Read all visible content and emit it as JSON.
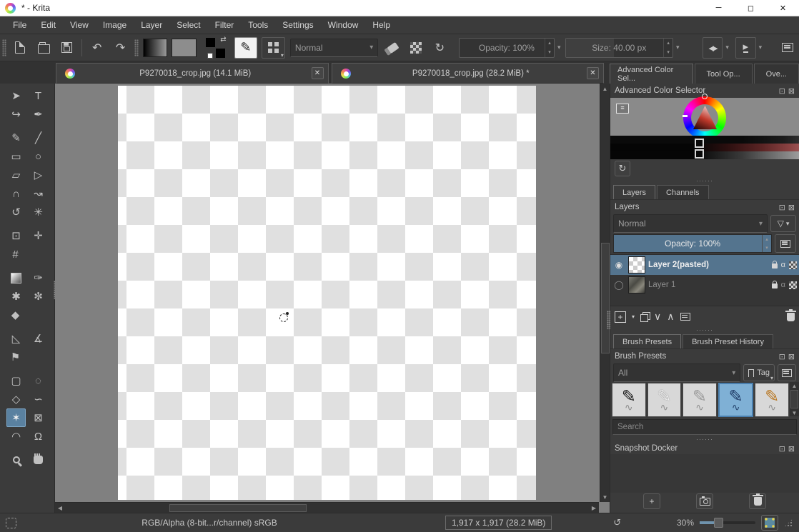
{
  "window": {
    "title": "* - Krita"
  },
  "window_controls": {
    "minimize": "─",
    "maximize": "◻",
    "close": "✕"
  },
  "menubar": {
    "items": [
      "File",
      "Edit",
      "View",
      "Image",
      "Layer",
      "Select",
      "Filter",
      "Tools",
      "Settings",
      "Window",
      "Help"
    ]
  },
  "toolbar": {
    "blending_mode": "Normal",
    "opacity": "Opacity: 100%",
    "size": "Size: 40.00 px"
  },
  "doc_tabs": [
    {
      "label": "P9270018_crop.jpg (14.1 MiB)"
    },
    {
      "label": "P9270018_crop.jpg (28.2 MiB) *"
    }
  ],
  "toolbox": {
    "tools": [
      {
        "name": "select-shapes",
        "glyph": "➤"
      },
      {
        "name": "text",
        "glyph": "T"
      },
      {
        "name": "edit-shapes",
        "glyph": "↪"
      },
      {
        "name": "calligraphy",
        "glyph": "✒"
      },
      {
        "name": "freehand-brush",
        "glyph": "✎"
      },
      {
        "name": "line",
        "glyph": "╱"
      },
      {
        "name": "rectangle",
        "glyph": "▭"
      },
      {
        "name": "ellipse",
        "glyph": "○"
      },
      {
        "name": "polygon",
        "glyph": "▱"
      },
      {
        "name": "polyline",
        "glyph": "▷"
      },
      {
        "name": "bezier-curve",
        "glyph": "∩"
      },
      {
        "name": "freehand-path",
        "glyph": "↝"
      },
      {
        "name": "dynamic-brush",
        "glyph": "↺"
      },
      {
        "name": "multibrush",
        "glyph": "✳"
      },
      {
        "name": "transform",
        "glyph": "⊡"
      },
      {
        "name": "move",
        "glyph": "✛"
      },
      {
        "name": "crop",
        "glyph": "#"
      },
      {
        "name": "color-sampler",
        "glyph": "✑"
      },
      {
        "name": "smart-patch",
        "glyph": "✱"
      },
      {
        "name": "colorize-mask",
        "glyph": "✼"
      },
      {
        "name": "fill",
        "glyph": "◆"
      },
      {
        "name": "assistants",
        "glyph": "◺"
      },
      {
        "name": "measure",
        "glyph": "∡"
      },
      {
        "name": "reference-images",
        "glyph": "⚑"
      },
      {
        "name": "rectangular-select",
        "glyph": "▢"
      },
      {
        "name": "elliptical-select",
        "glyph": "◌"
      },
      {
        "name": "polygonal-select",
        "glyph": "◇"
      },
      {
        "name": "freehand-select",
        "glyph": "∽"
      },
      {
        "name": "similar-color-select",
        "glyph": "✶"
      },
      {
        "name": "contiguous-select",
        "glyph": "⊠"
      },
      {
        "name": "bezier-select",
        "glyph": "◠"
      },
      {
        "name": "magnetic-select",
        "glyph": "Ω"
      }
    ]
  },
  "icons": {
    "close": "✕",
    "dropdown": "▾",
    "spin_up": "▴",
    "spin_down": "▾",
    "undo": "↶",
    "redo": "↷",
    "reload": "↻",
    "swap": "⇄",
    "funnel": "▽",
    "eye_open": "◉",
    "eye_closed": "◯",
    "alpha": "α",
    "add": "+",
    "move_down": "∨",
    "move_up": "∧",
    "arrow_up": "▲",
    "arrow_down": "▼",
    "arrow_left": "◀",
    "arrow_right": "▶",
    "mirror_h": "◂▸",
    "mirror_v": "▸",
    "settings_lines": "≡",
    "float_docker": "⊡",
    "close_docker": "⊠",
    "reset_rotation": "↺"
  },
  "dockers": {
    "top_tabs": [
      {
        "label": "Advanced Color Sel..."
      },
      {
        "label": "Tool Op..."
      },
      {
        "label": "Ove..."
      }
    ],
    "color_selector": {
      "title": "Advanced Color Selector"
    },
    "layers": {
      "tab_layers": "Layers",
      "tab_channels": "Channels",
      "title": "Layers",
      "blending_mode": "Normal",
      "opacity": "Opacity: 100%",
      "rows": [
        {
          "name": "Layer 2(pasted)"
        },
        {
          "name": "Layer 1"
        }
      ]
    },
    "brushes": {
      "tab_presets": "Brush Presets",
      "tab_history": "Brush Preset History",
      "title": "Brush Presets",
      "filter_all": "All",
      "tag": "Tag",
      "search_placeholder": "Search",
      "presets": [
        {
          "glyph": "✎",
          "color": "#1a1a1a"
        },
        {
          "glyph": "✎",
          "color": "#e8e8e8"
        },
        {
          "glyph": "✎",
          "color": "#9a9a9a"
        },
        {
          "glyph": "✎",
          "color": "#1f3b66"
        },
        {
          "glyph": "✎",
          "color": "#b97722"
        }
      ]
    },
    "snapshot": {
      "title": "Snapshot Docker"
    }
  },
  "statusbar": {
    "colorspace": "RGB/Alpha (8-bit...r/channel)  sRGB",
    "size_info": "1,917 x 1,917 (28.2 MiB)",
    "zoom_level": "30%"
  },
  "colors": {
    "accent_blue": "#54748e",
    "brush_selected": "#7fb0d5",
    "panel": "#3b3b3b",
    "canvas_checker": "#e0e0e0",
    "viewport_gray": "#808080"
  }
}
